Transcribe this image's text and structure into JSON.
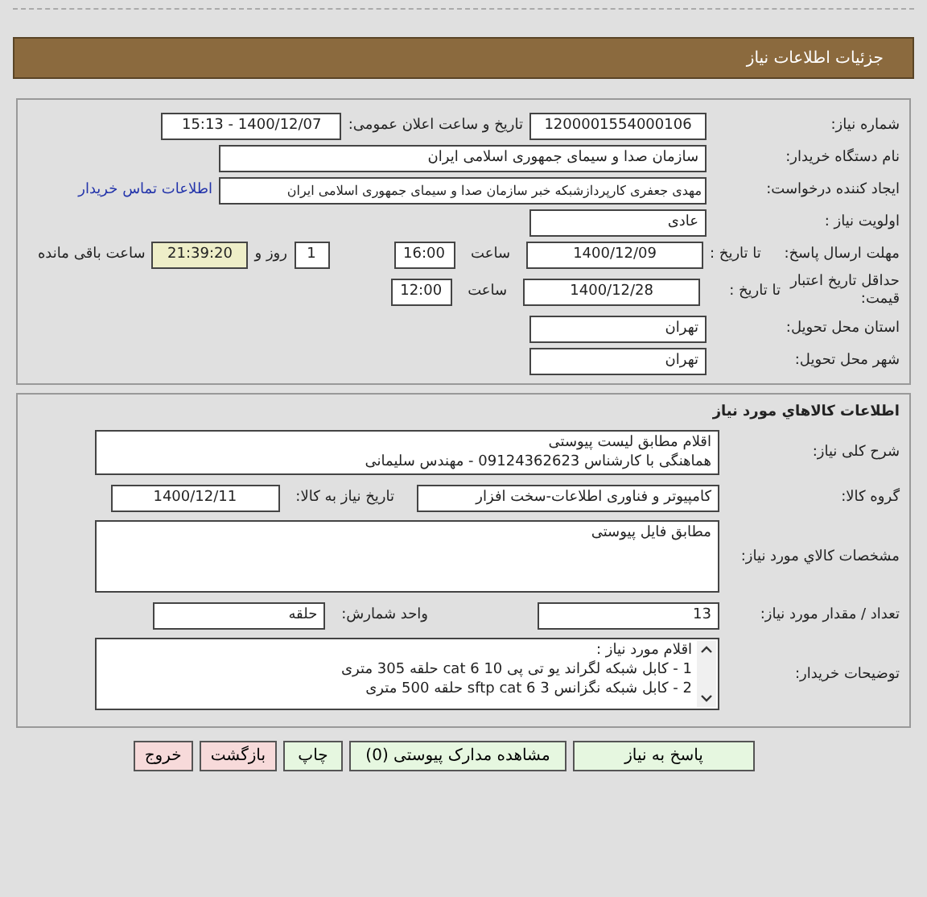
{
  "header": {
    "title": "جزئیات اطلاعات نیاز"
  },
  "need_info": {
    "need_number": {
      "label": "شماره نیاز:",
      "value": "1200001554000106"
    },
    "announce_datetime": {
      "label": "تاریخ و ساعت اعلان عمومی:",
      "value": "1400/12/07 - 15:13"
    },
    "buyer_org": {
      "label": "نام دستگاه خریدار:",
      "value": "سازمان صدا و سیمای جمهوری اسلامی ایران"
    },
    "requester": {
      "label": "ایجاد کننده درخواست:",
      "value": "مهدی جعفری کارپردازشبکه خبر سازمان صدا و سیمای جمهوری اسلامی ایران",
      "link": "اطلاعات تماس خریدار"
    },
    "priority": {
      "label": "اولویت نیاز :",
      "value": "عادی"
    },
    "reply_deadline": {
      "label": "مهلت ارسال پاسخ:",
      "date_label": "تا تاریخ :",
      "date": "1400/12/09",
      "time_label": "ساعت",
      "time": "16:00",
      "days": "1",
      "days_label": "روز و",
      "remaining": "21:39:20",
      "remaining_label": "ساعت باقی مانده"
    },
    "price_validity": {
      "label": "حداقل تاریخ اعتبار قیمت:",
      "date_label": "تا تاریخ :",
      "date": "1400/12/28",
      "time_label": "ساعت",
      "time": "12:00"
    },
    "province": {
      "label": "استان محل تحویل:",
      "value": "تهران"
    },
    "city": {
      "label": "شهر محل تحویل:",
      "value": "تهران"
    }
  },
  "goods": {
    "title": "اطلاعات کالاهاي مورد نیاز",
    "description": {
      "label": "شرح کلی نیاز:",
      "lines": [
        "اقلام مطابق لیست پیوستی",
        "هماهنگی با کارشناس 09124362623 - مهندس سلیمانی"
      ]
    },
    "group": {
      "label": "گروه کالا:",
      "value": "کامپیوتر و فناوری اطلاعات-سخت افزار",
      "need_date_label": "تاریخ نیاز به کالا:",
      "need_date": "1400/12/11"
    },
    "specs": {
      "label": "مشخصات کالاي مورد نیاز:",
      "value": "مطابق فایل پیوستی"
    },
    "quantity": {
      "label": "تعداد / مقدار مورد نیاز:",
      "value": "13",
      "unit_label": "واحد شمارش:",
      "unit": "حلقه"
    },
    "buyer_notes": {
      "label": "توضیحات خریدار:",
      "lines": [
        "اقلام مورد نیاز :",
        "1 - کابل شبکه لگراند یو تی پی 10  cat 6 حلقه  305 متری",
        "2 - کابل شبکه نگزانس 3  sftp cat 6 حلقه  500 متری"
      ]
    }
  },
  "buttons": [
    {
      "label": "پاسخ به نیاز",
      "kind": "normal"
    },
    {
      "label": "مشاهده مدارک پیوستی (0)",
      "kind": "normal"
    },
    {
      "label": "چاپ",
      "kind": "normal"
    },
    {
      "label": "بازگشت",
      "kind": "danger"
    },
    {
      "label": "خروج",
      "kind": "danger"
    }
  ]
}
